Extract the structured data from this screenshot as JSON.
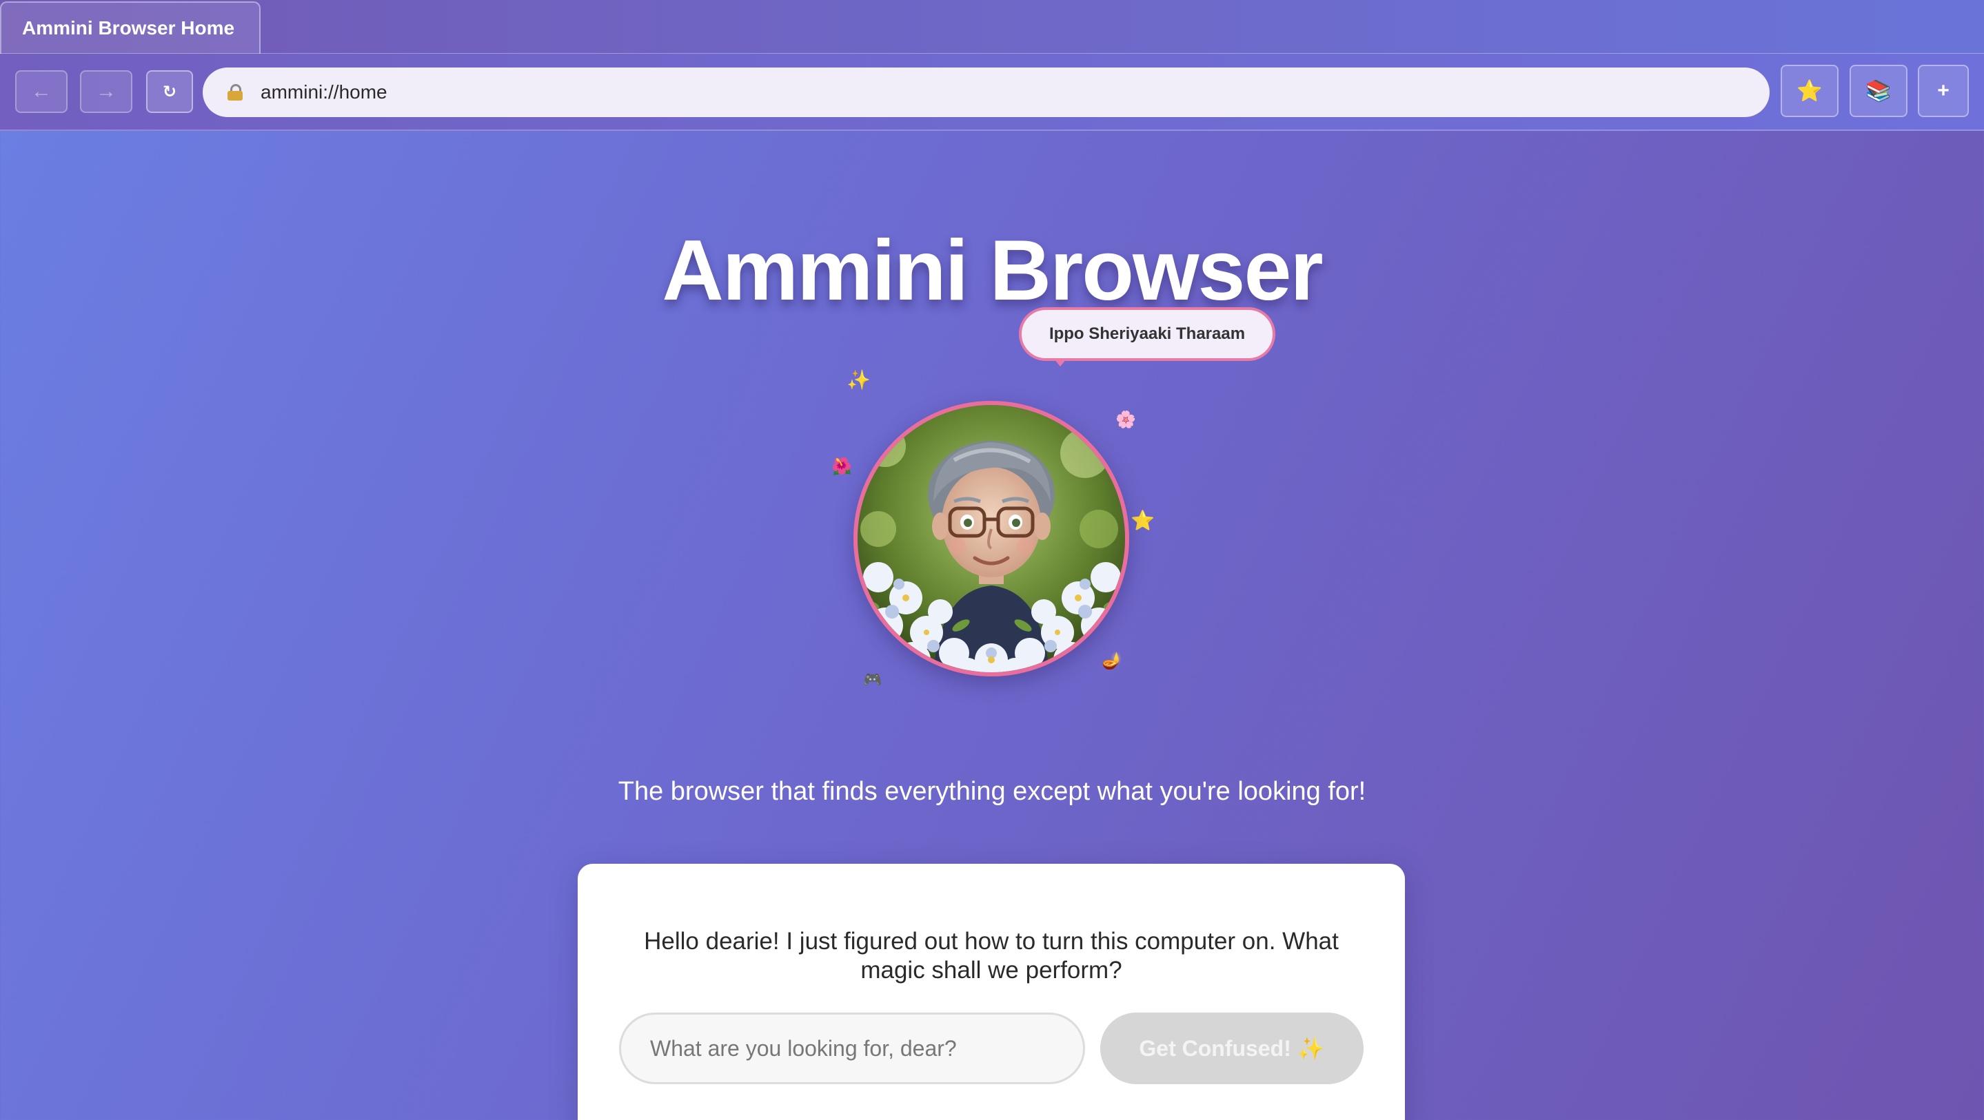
{
  "tab": {
    "title": "Ammini Browser Home"
  },
  "toolbar": {
    "back_label": "←",
    "forward_label": "→",
    "reload_label": "↻",
    "url": "ammini://home",
    "bookmark_label": "⭐",
    "library_label": "📚",
    "new_tab_label": "+"
  },
  "hero": {
    "title": "Ammini Browser",
    "speech_bubble": "Ippo Sheriyaaki Tharaam",
    "tagline": "The browser that finds everything except what you're looking for!",
    "decorations": {
      "sparkles": "✨",
      "flower_purple": "🌸",
      "flower_red": "🌺",
      "star": "⭐",
      "lamp": "🪔",
      "gamepad": "🎮"
    }
  },
  "search": {
    "greeting": "Hello dearie! I just figured out how to turn this computer on. What magic shall we perform?",
    "placeholder": "What are you looking for, dear?",
    "button_label": "Get Confused! ✨"
  }
}
